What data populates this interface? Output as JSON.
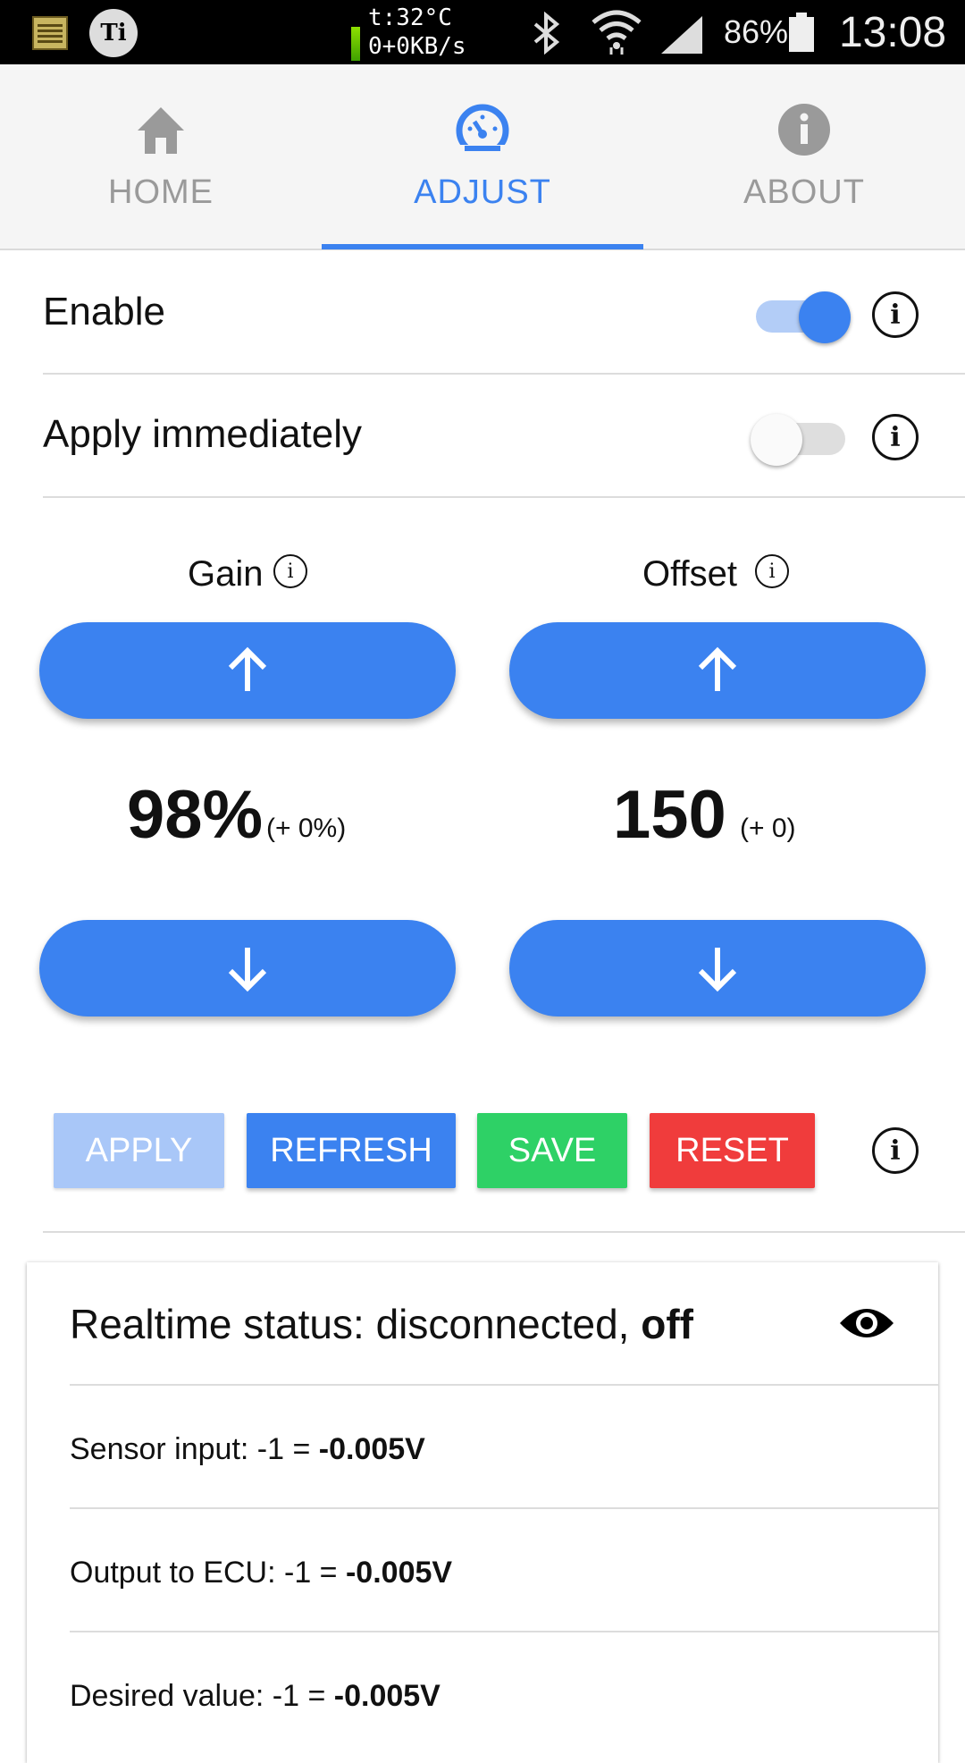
{
  "status_bar": {
    "temperature": "t:32°C",
    "network_speed": "0+0KB/s",
    "gear_badge": "Ti",
    "battery_percent": "86%",
    "time": "13:08"
  },
  "tabs": [
    {
      "label": "HOME",
      "icon": "home-icon",
      "active": false
    },
    {
      "label": "ADJUST",
      "icon": "speedometer-icon",
      "active": true
    },
    {
      "label": "ABOUT",
      "icon": "info-icon",
      "active": false
    }
  ],
  "settings": {
    "enable": {
      "label": "Enable",
      "on": true
    },
    "apply_immediately": {
      "label": "Apply immediately",
      "on": false
    }
  },
  "info_glyph": "i",
  "gain": {
    "title": "Gain",
    "value": "98%",
    "delta": "(+ 0%)"
  },
  "offset": {
    "title": "Offset",
    "value": "150",
    "delta": "(+ 0)"
  },
  "actions": {
    "apply": "APPLY",
    "refresh": "REFRESH",
    "save": "SAVE",
    "reset": "RESET"
  },
  "colors": {
    "accent": "#3b82f0",
    "apply_disabled": "#a9c7f8",
    "save": "#2ed166",
    "reset": "#f03c3c"
  },
  "realtime": {
    "title_prefix": "Realtime status: disconnected, ",
    "title_state": "off",
    "lines": [
      {
        "label": "Sensor input: -1 = ",
        "value": "-0.005V"
      },
      {
        "label": "Output to ECU: -1 = ",
        "value": "-0.005V"
      },
      {
        "label": "Desired value: -1 = ",
        "value": "-0.005V"
      }
    ]
  }
}
